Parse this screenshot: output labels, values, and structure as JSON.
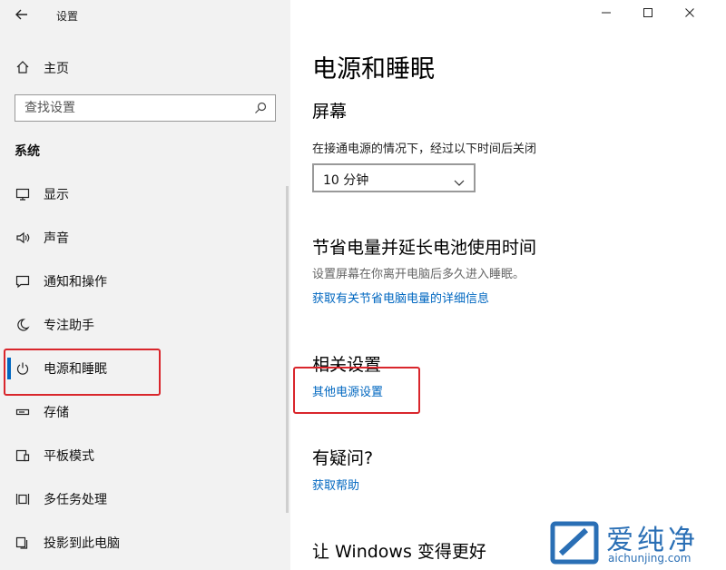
{
  "app": {
    "title": "设置",
    "back_icon": "back-arrow-icon"
  },
  "window_controls": {
    "minimize": "—",
    "maximize": "☐",
    "close": "✕"
  },
  "sidebar": {
    "home_label": "主页",
    "search_placeholder": "查找设置",
    "section_title": "系统",
    "items": [
      {
        "label": "显示",
        "icon": "display-icon"
      },
      {
        "label": "声音",
        "icon": "speaker-icon"
      },
      {
        "label": "通知和操作",
        "icon": "notification-icon"
      },
      {
        "label": "专注助手",
        "icon": "moon-icon"
      },
      {
        "label": "电源和睡眠",
        "icon": "power-icon",
        "active": true
      },
      {
        "label": "存储",
        "icon": "storage-icon"
      },
      {
        "label": "平板模式",
        "icon": "tablet-icon"
      },
      {
        "label": "多任务处理",
        "icon": "multitask-icon"
      },
      {
        "label": "投影到此电脑",
        "icon": "project-icon"
      }
    ]
  },
  "main": {
    "page_title": "电源和睡眠",
    "screen": {
      "heading": "屏幕",
      "desc": "在接通电源的情况下，经过以下时间后关闭",
      "dropdown_value": "10 分钟"
    },
    "battery": {
      "heading": "节省电量并延长电池使用时间",
      "desc": "设置屏幕在你离开电脑后多久进入睡眠。",
      "link": "获取有关节省电脑电量的详细信息"
    },
    "related": {
      "heading": "相关设置",
      "link": "其他电源设置"
    },
    "question": {
      "heading": "有疑问?",
      "link": "获取帮助"
    },
    "improve": {
      "heading": "让 Windows 变得更好"
    }
  },
  "watermark": {
    "text": "爱纯净",
    "domain": "aichunjing.com"
  },
  "colors": {
    "accent": "#0067c0",
    "highlight": "#d9262c",
    "sidebar_bg": "#f2f2f2"
  }
}
